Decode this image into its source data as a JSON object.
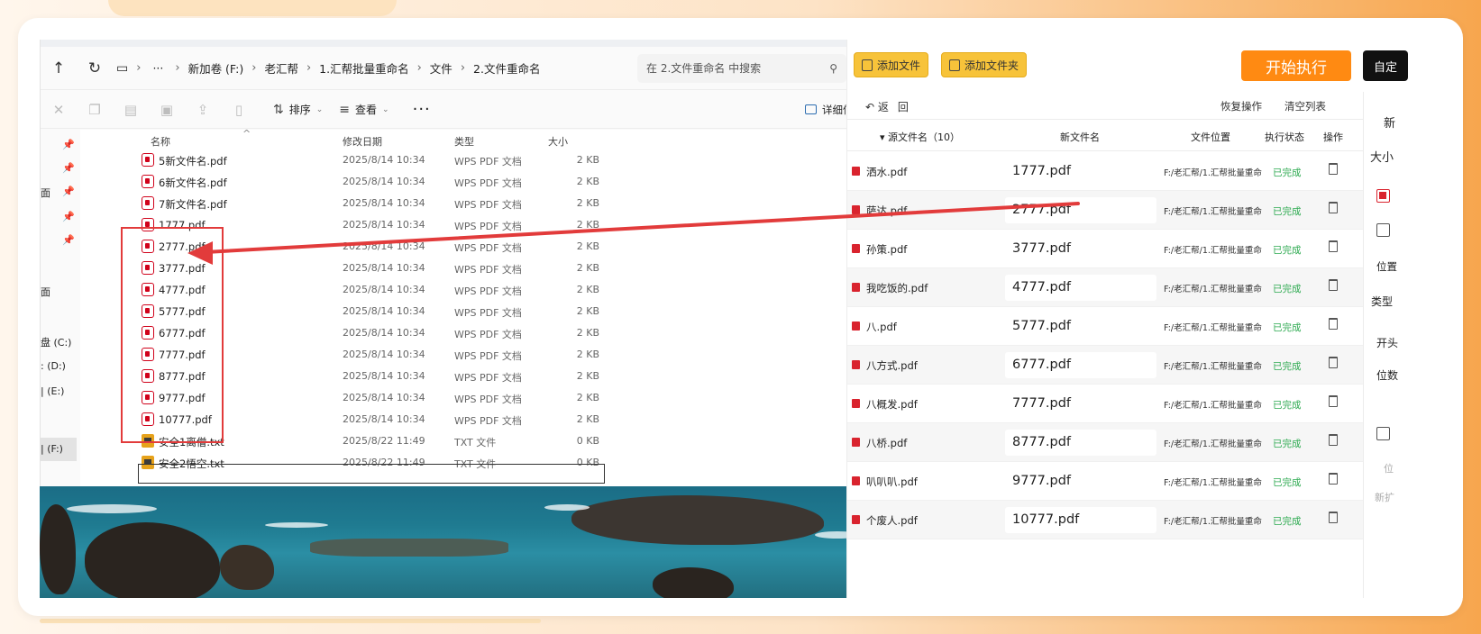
{
  "explorer": {
    "nav": {
      "up": "↑",
      "refresh": "↻",
      "pc_icon": "▭",
      "chevron": "›",
      "more": "···"
    },
    "breadcrumb": [
      "新加卷 (F:)",
      "老汇帮",
      "1.汇帮批量重命名",
      "文件",
      "2.文件重命名"
    ],
    "search_placeholder": "在 2.文件重命名 中搜索",
    "toolbar": {
      "sort": "排序",
      "view": "查看",
      "more": "···",
      "details": "详细信息"
    },
    "columns": {
      "name": "名称",
      "date": "修改日期",
      "type": "类型",
      "size": "大小"
    },
    "sidebar": {
      "drive_c": "盘 (C:)",
      "drive_d": ": (D:)",
      "drive_e": "| (E:)",
      "drive_f": "| (F:)",
      "item1": "面",
      "item2": "面"
    },
    "files": [
      {
        "name": "5新文件名.pdf",
        "date": "2025/8/14 10:34",
        "type": "WPS PDF 文档",
        "size": "2 KB",
        "icon": "pdf"
      },
      {
        "name": "6新文件名.pdf",
        "date": "2025/8/14 10:34",
        "type": "WPS PDF 文档",
        "size": "2 KB",
        "icon": "pdf"
      },
      {
        "name": "7新文件名.pdf",
        "date": "2025/8/14 10:34",
        "type": "WPS PDF 文档",
        "size": "2 KB",
        "icon": "pdf"
      },
      {
        "name": "1777.pdf",
        "date": "2025/8/14 10:34",
        "type": "WPS PDF 文档",
        "size": "2 KB",
        "icon": "pdf"
      },
      {
        "name": "2777.pdf",
        "date": "2025/8/14 10:34",
        "type": "WPS PDF 文档",
        "size": "2 KB",
        "icon": "pdf"
      },
      {
        "name": "3777.pdf",
        "date": "2025/8/14 10:34",
        "type": "WPS PDF 文档",
        "size": "2 KB",
        "icon": "pdf"
      },
      {
        "name": "4777.pdf",
        "date": "2025/8/14 10:34",
        "type": "WPS PDF 文档",
        "size": "2 KB",
        "icon": "pdf"
      },
      {
        "name": "5777.pdf",
        "date": "2025/8/14 10:34",
        "type": "WPS PDF 文档",
        "size": "2 KB",
        "icon": "pdf"
      },
      {
        "name": "6777.pdf",
        "date": "2025/8/14 10:34",
        "type": "WPS PDF 文档",
        "size": "2 KB",
        "icon": "pdf"
      },
      {
        "name": "7777.pdf",
        "date": "2025/8/14 10:34",
        "type": "WPS PDF 文档",
        "size": "2 KB",
        "icon": "pdf"
      },
      {
        "name": "8777.pdf",
        "date": "2025/8/14 10:34",
        "type": "WPS PDF 文档",
        "size": "2 KB",
        "icon": "pdf"
      },
      {
        "name": "9777.pdf",
        "date": "2025/8/14 10:34",
        "type": "WPS PDF 文档",
        "size": "2 KB",
        "icon": "pdf"
      },
      {
        "name": "10777.pdf",
        "date": "2025/8/14 10:34",
        "type": "WPS PDF 文档",
        "size": "2 KB",
        "icon": "pdf"
      },
      {
        "name": "安全1离僧.txt",
        "date": "2025/8/22 11:49",
        "type": "TXT 文件",
        "size": "0 KB",
        "icon": "txt"
      },
      {
        "name": "安全2悟空.txt",
        "date": "2025/8/22 11:49",
        "type": "TXT 文件",
        "size": "0 KB",
        "icon": "txt"
      }
    ]
  },
  "renamer": {
    "add_files": "添加文件",
    "add_folder": "添加文件夹",
    "start": "开始执行",
    "custom": "自定",
    "undo": "↶ 返",
    "redo": "回",
    "restore": "恢复操作",
    "clear": "清空列表",
    "columns": {
      "src": "▾ 源文件名（10）",
      "new": "新文件名",
      "path": "文件位置",
      "status": "执行状态",
      "op": "操作"
    },
    "rows": [
      {
        "src": "洒水.pdf",
        "new": "1777.pdf",
        "path": "F:/老汇帮/1.汇帮批量重命",
        "status": "已完成"
      },
      {
        "src": "萨达.pdf",
        "new": "2777.pdf",
        "path": "F:/老汇帮/1.汇帮批量重命",
        "status": "已完成"
      },
      {
        "src": "孙策.pdf",
        "new": "3777.pdf",
        "path": "F:/老汇帮/1.汇帮批量重命",
        "status": "已完成"
      },
      {
        "src": "我吃饭的.pdf",
        "new": "4777.pdf",
        "path": "F:/老汇帮/1.汇帮批量重命",
        "status": "已完成"
      },
      {
        "src": "八.pdf",
        "new": "5777.pdf",
        "path": "F:/老汇帮/1.汇帮批量重命",
        "status": "已完成"
      },
      {
        "src": "八方式.pdf",
        "new": "6777.pdf",
        "path": "F:/老汇帮/1.汇帮批量重命",
        "status": "已完成"
      },
      {
        "src": "八概发.pdf",
        "new": "7777.pdf",
        "path": "F:/老汇帮/1.汇帮批量重命",
        "status": "已完成"
      },
      {
        "src": "八桥.pdf",
        "new": "8777.pdf",
        "path": "F:/老汇帮/1.汇帮批量重命",
        "status": "已完成"
      },
      {
        "src": "叭叭叭.pdf",
        "new": "9777.pdf",
        "path": "F:/老汇帮/1.汇帮批量重命",
        "status": "已完成"
      },
      {
        "src": "个废人.pdf",
        "new": "10777.pdf",
        "path": "F:/老汇帮/1.汇帮批量重命",
        "status": "已完成"
      }
    ],
    "side": {
      "new": "新",
      "size": "大小",
      "position": "位置",
      "type": "类型",
      "begin": "开头",
      "digits": "位数",
      "hint1": "位",
      "hint2": "新扩"
    }
  },
  "colors": {
    "accent_orange": "#ff8a12",
    "btn_yellow": "#f7c33a",
    "status_green": "#2daa50",
    "highlight_red": "#e23b3b"
  }
}
